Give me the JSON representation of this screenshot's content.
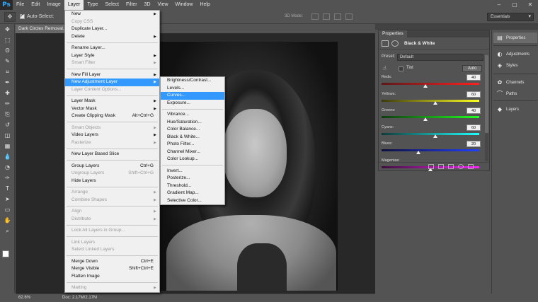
{
  "app": {
    "logo": "Ps"
  },
  "menubar": [
    "File",
    "Edit",
    "Image",
    "Layer",
    "Type",
    "Select",
    "Filter",
    "3D",
    "View",
    "Window",
    "Help"
  ],
  "active_menu_index": 3,
  "window_controls": [
    "–",
    "▢",
    "✕"
  ],
  "options_bar": {
    "auto_select_label": "Auto-Select:",
    "mode_label": "3D Mode:",
    "workspace": "Essentials"
  },
  "document": {
    "tab_title": "Dark Circles Removal.jpg @ 62.6% (RGB/8*)",
    "zoom": "62.6%",
    "doc_size": "Doc: 2.17M/2.17M"
  },
  "layer_menu": {
    "groups": [
      [
        {
          "label": "New",
          "arrow": true
        },
        {
          "label": "Copy CSS",
          "disabled": true
        },
        {
          "label": "Duplicate Layer..."
        },
        {
          "label": "Delete",
          "arrow": true
        }
      ],
      [
        {
          "label": "Rename Layer..."
        },
        {
          "label": "Layer Style",
          "arrow": true
        },
        {
          "label": "Smart Filter",
          "disabled": true,
          "arrow": true
        }
      ],
      [
        {
          "label": "New Fill Layer",
          "arrow": true
        },
        {
          "label": "New Adjustment Layer",
          "arrow": true,
          "highlight": true
        },
        {
          "label": "Layer Content Options...",
          "disabled": true
        }
      ],
      [
        {
          "label": "Layer Mask",
          "arrow": true
        },
        {
          "label": "Vector Mask",
          "arrow": true
        },
        {
          "label": "Create Clipping Mask",
          "shortcut": "Alt+Ctrl+G"
        }
      ],
      [
        {
          "label": "Smart Objects",
          "disabled": true,
          "arrow": true
        },
        {
          "label": "Video Layers",
          "arrow": true
        },
        {
          "label": "Rasterize",
          "disabled": true,
          "arrow": true
        }
      ],
      [
        {
          "label": "New Layer Based Slice"
        }
      ],
      [
        {
          "label": "Group Layers",
          "shortcut": "Ctrl+G"
        },
        {
          "label": "Ungroup Layers",
          "shortcut": "Shift+Ctrl+G",
          "disabled": true
        },
        {
          "label": "Hide Layers"
        }
      ],
      [
        {
          "label": "Arrange",
          "disabled": true,
          "arrow": true
        },
        {
          "label": "Combine Shapes",
          "disabled": true,
          "arrow": true
        }
      ],
      [
        {
          "label": "Align",
          "disabled": true,
          "arrow": true
        },
        {
          "label": "Distribute",
          "disabled": true,
          "arrow": true
        }
      ],
      [
        {
          "label": "Lock All Layers in Group...",
          "disabled": true
        }
      ],
      [
        {
          "label": "Link Layers",
          "disabled": true
        },
        {
          "label": "Select Linked Layers",
          "disabled": true
        }
      ],
      [
        {
          "label": "Merge Down",
          "shortcut": "Ctrl+E"
        },
        {
          "label": "Merge Visible",
          "shortcut": "Shift+Ctrl+E"
        },
        {
          "label": "Flatten Image"
        }
      ],
      [
        {
          "label": "Matting",
          "disabled": true,
          "arrow": true
        }
      ]
    ]
  },
  "adjustment_submenu": {
    "groups": [
      [
        {
          "label": "Brightness/Contrast..."
        },
        {
          "label": "Levels..."
        },
        {
          "label": "Curves...",
          "highlight": true
        },
        {
          "label": "Exposure..."
        }
      ],
      [
        {
          "label": "Vibrance..."
        },
        {
          "label": "Hue/Saturation..."
        },
        {
          "label": "Color Balance..."
        },
        {
          "label": "Black & White..."
        },
        {
          "label": "Photo Filter..."
        },
        {
          "label": "Channel Mixer..."
        },
        {
          "label": "Color Lookup..."
        }
      ],
      [
        {
          "label": "Invert..."
        },
        {
          "label": "Posterize..."
        },
        {
          "label": "Threshold..."
        },
        {
          "label": "Gradient Map..."
        },
        {
          "label": "Selective Color..."
        }
      ]
    ]
  },
  "properties": {
    "tab": "Properties",
    "title": "Black & White",
    "preset_label": "Preset:",
    "preset_value": "Default",
    "tint_label": "Tint",
    "auto_label": "Auto",
    "sliders": [
      {
        "label": "Reds:",
        "value": "40",
        "percent": 0.45,
        "gradient": "linear-gradient(90deg,#5a1a1a,#ff2020)"
      },
      {
        "label": "Yellows:",
        "value": "60",
        "percent": 0.55,
        "gradient": "linear-gradient(90deg,#3a3a10,#ffff20)"
      },
      {
        "label": "Greens:",
        "value": "40",
        "percent": 0.45,
        "gradient": "linear-gradient(90deg,#103a10,#20ff20)"
      },
      {
        "label": "Cyans:",
        "value": "60",
        "percent": 0.55,
        "gradient": "linear-gradient(90deg,#103a3a,#20ffff)"
      },
      {
        "label": "Blues:",
        "value": "20",
        "percent": 0.38,
        "gradient": "linear-gradient(90deg,#10103a,#2040ff)"
      },
      {
        "label": "Magentas:",
        "value": "",
        "percent": 0.5,
        "gradient": "linear-gradient(90deg,#3a103a,#ff20ff)"
      }
    ]
  },
  "dock": [
    {
      "label": "Properties",
      "icon": "properties-icon",
      "glyph": "▤",
      "selected": true
    },
    {
      "label": "Adjustments",
      "icon": "adjustments-icon",
      "glyph": "◐"
    },
    {
      "label": "Styles",
      "icon": "styles-icon",
      "glyph": "◈"
    },
    {
      "label": "Channels",
      "icon": "channels-icon",
      "glyph": "✿"
    },
    {
      "label": "Paths",
      "icon": "paths-icon",
      "glyph": "⌒"
    },
    {
      "label": "Layers",
      "icon": "layers-icon",
      "glyph": "◆"
    }
  ],
  "tools": [
    "move-tool",
    "marquee-tool",
    "lasso-tool",
    "quick-select-tool",
    "crop-tool",
    "eyedropper-tool",
    "healing-tool",
    "brush-tool",
    "clone-tool",
    "history-brush-tool",
    "eraser-tool",
    "gradient-tool",
    "blur-tool",
    "dodge-tool",
    "pen-tool",
    "type-tool",
    "path-select-tool",
    "shape-tool",
    "hand-tool",
    "zoom-tool"
  ],
  "tool_glyphs": [
    "✥",
    "⬚",
    "ʘ",
    "✎",
    "⌗",
    "✒",
    "✚",
    "✏",
    "⎘",
    "↺",
    "◫",
    "▦",
    "💧",
    "◔",
    "✑",
    "T",
    "➤",
    "▭",
    "✋",
    "⌕"
  ]
}
